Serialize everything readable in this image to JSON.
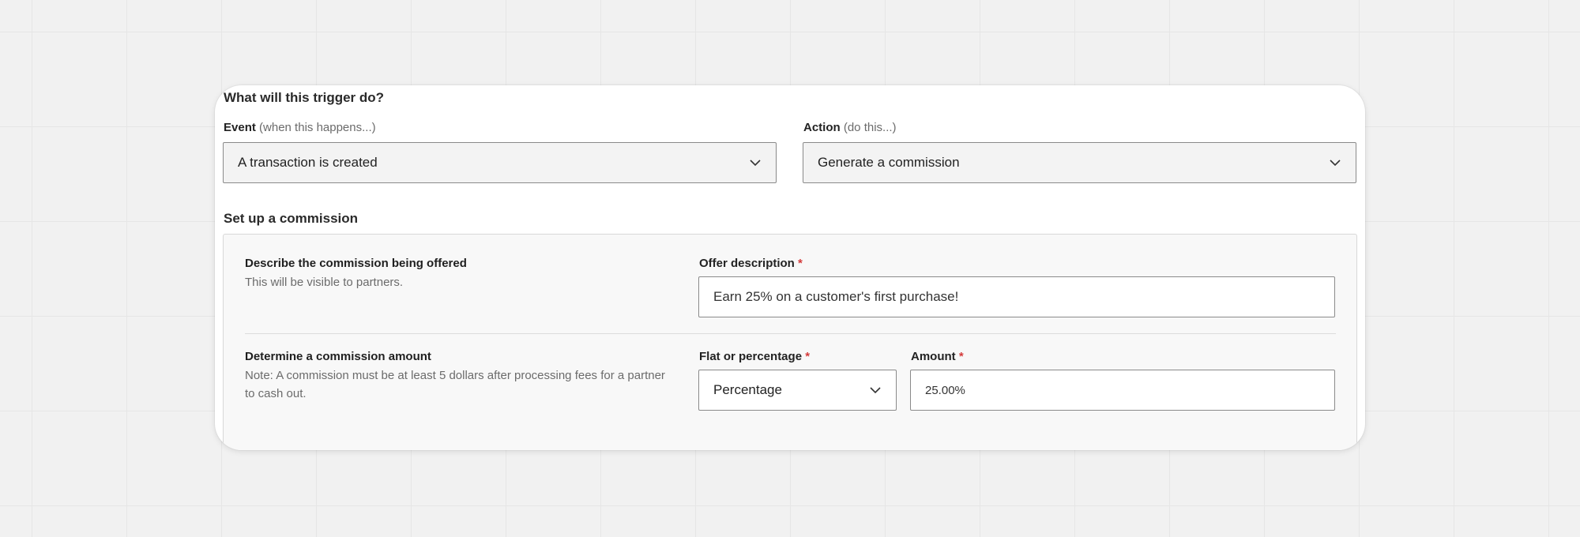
{
  "trigger": {
    "title": "What will this trigger do?",
    "event": {
      "label": "Event",
      "hint": "(when this happens...)",
      "value": "A transaction is created",
      "icon": "chevron-down-icon"
    },
    "action": {
      "label": "Action",
      "hint": "(do this...)",
      "value": "Generate a commission",
      "icon": "chevron-down-icon"
    }
  },
  "commission": {
    "title": "Set up a commission",
    "describe": {
      "title": "Describe the commission being offered",
      "description": "This will be visible to partners.",
      "offer_label": "Offer description",
      "offer_value": "Earn 25% on a customer's first purchase!"
    },
    "amount_section": {
      "title": "Determine a commission amount",
      "description": "Note: A commission must be at least 5 dollars after processing fees for a partner to cash out.",
      "type_label": "Flat or percentage",
      "type_value": "Percentage",
      "amount_label": "Amount",
      "amount_value": "25.00%"
    },
    "required_marker": "*"
  },
  "colors": {
    "required": "#d43a3a",
    "background": "#f1f1f1",
    "card": "#ffffff"
  }
}
